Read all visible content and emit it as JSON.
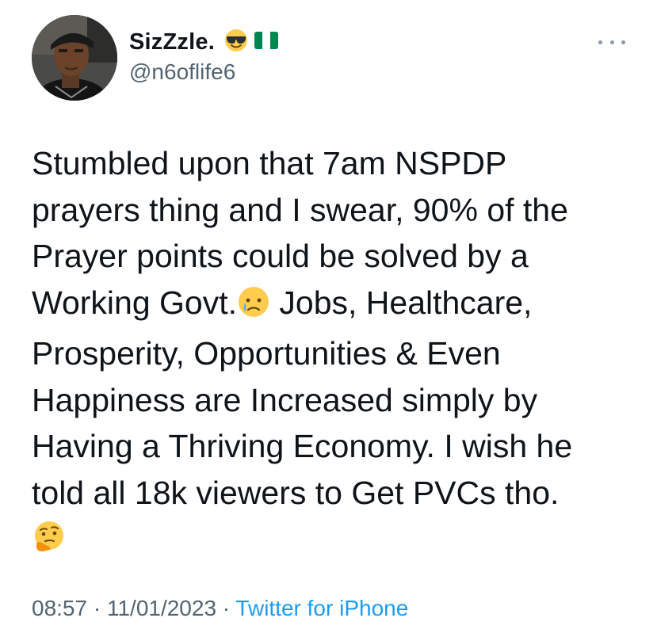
{
  "author": {
    "display_name": "SizZzle.",
    "handle": "@n6oflife6",
    "name_emojis": [
      "sunglasses-emoji",
      "nigeria-flag-emoji"
    ]
  },
  "tweet": {
    "text_part1": "Stumbled upon that 7am NSPDP\nprayers thing and I swear, 90% of the\nPrayer points could be solved by a\nWorking Govt.",
    "text_part2": " Jobs, Healthcare,\nProsperity, Opportunities & Even\nHappiness are Increased simply by\nHaving a Thriving Economy. I wish he\ntold all 18k viewers to Get PVCs tho.\n",
    "emojis": [
      "crying-face-emoji",
      "thinking-face-emoji"
    ]
  },
  "footer": {
    "time": "08:57",
    "separator1": " · ",
    "date": "11/01/2023",
    "separator2": " · ",
    "source": "Twitter for iPhone"
  },
  "colors": {
    "text": "#0f1419",
    "secondary": "#536471",
    "link": "#1d9bf0"
  }
}
